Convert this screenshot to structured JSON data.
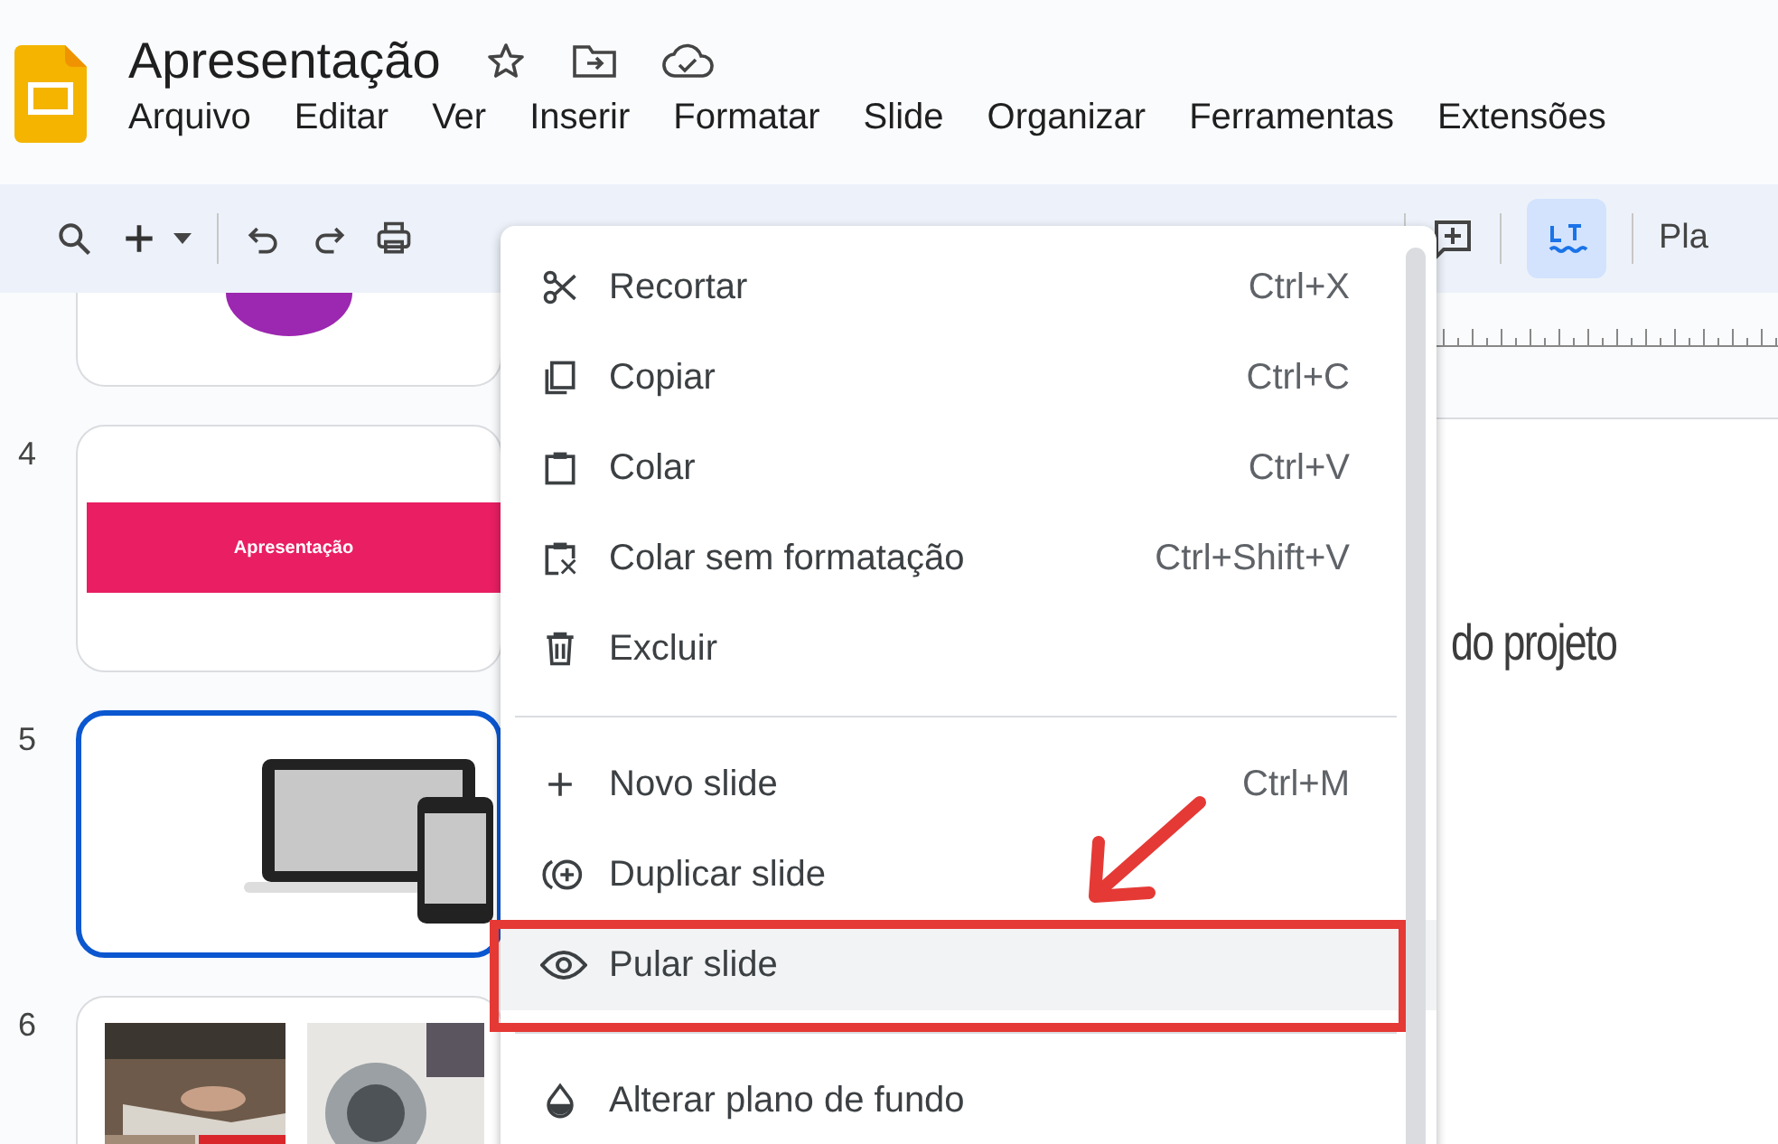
{
  "document": {
    "title": "Apresentação"
  },
  "menu_bar": [
    "Arquivo",
    "Editar",
    "Ver",
    "Inserir",
    "Formatar",
    "Slide",
    "Organizar",
    "Ferramentas",
    "Extensões"
  ],
  "toolbar": {
    "cut_label": "Pla"
  },
  "slides": [
    {
      "kind": "circle",
      "selected": false
    },
    {
      "number": "4",
      "kind": "banner",
      "banner_text": "Apresentação",
      "selected": false
    },
    {
      "number": "5",
      "kind": "devices",
      "selected": true
    },
    {
      "number": "6",
      "kind": "photos",
      "selected": false
    }
  ],
  "canvas": {
    "title_fragment": "do projeto"
  },
  "context_menu": {
    "items": [
      {
        "kind": "item",
        "label": "Recortar",
        "shortcut": "Ctrl+X",
        "selected": false
      },
      {
        "kind": "item",
        "label": "Copiar",
        "shortcut": "Ctrl+C",
        "selected": false
      },
      {
        "kind": "item",
        "label": "Colar",
        "shortcut": "Ctrl+V",
        "selected": false
      },
      {
        "kind": "item",
        "label": "Colar sem formatação",
        "shortcut": "Ctrl+Shift+V",
        "selected": false
      },
      {
        "kind": "item",
        "label": "Excluir",
        "selected": false
      },
      {
        "kind": "divider"
      },
      {
        "kind": "item",
        "label": "Novo slide",
        "shortcut": "Ctrl+M",
        "selected": false
      },
      {
        "kind": "item",
        "label": "Duplicar slide",
        "selected": false
      },
      {
        "kind": "item",
        "label": "Pular slide",
        "selected": true
      },
      {
        "kind": "divider"
      },
      {
        "kind": "item",
        "label": "Alterar plano de fundo",
        "selected": false
      }
    ]
  }
}
